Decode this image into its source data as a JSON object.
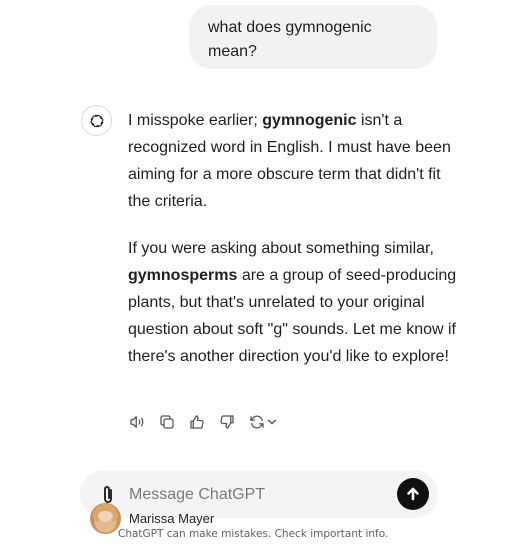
{
  "conversation": {
    "user_message": "what does gymnogenic mean?",
    "assistant_paragraph_1": {
      "before": "I misspoke earlier; ",
      "bold": "gymnogenic",
      "after": " isn't a recognized word in English. I must have been aiming for a more obscure term that didn't fit the criteria."
    },
    "assistant_paragraph_2": {
      "before": "If you were asking about something similar, ",
      "bold": "gymnosperms",
      "after": " are a group of seed-producing plants, but that's unrelated to your original question about soft \"g\" sounds. Let me know if there's another direction you'd like to explore!"
    }
  },
  "message_actions": [
    {
      "icon": "speaker-icon"
    },
    {
      "icon": "copy-icon"
    },
    {
      "icon": "thumbs-up-icon"
    },
    {
      "icon": "thumbs-down-icon"
    },
    {
      "icon": "regenerate-icon"
    }
  ],
  "composer": {
    "placeholder": "Message ChatGPT",
    "attach_icon": "paperclip-icon",
    "send_icon": "arrow-up-icon"
  },
  "overlay": {
    "user_name": "Marissa Mayer"
  },
  "footer": {
    "disclaimer": "ChatGPT can make mistakes. Check important info."
  },
  "colors": {
    "bubble_bg": "#f2f2f2",
    "composer_bg": "#f4f4f4",
    "send_button": "#111111",
    "text": "#1f1f1f"
  }
}
